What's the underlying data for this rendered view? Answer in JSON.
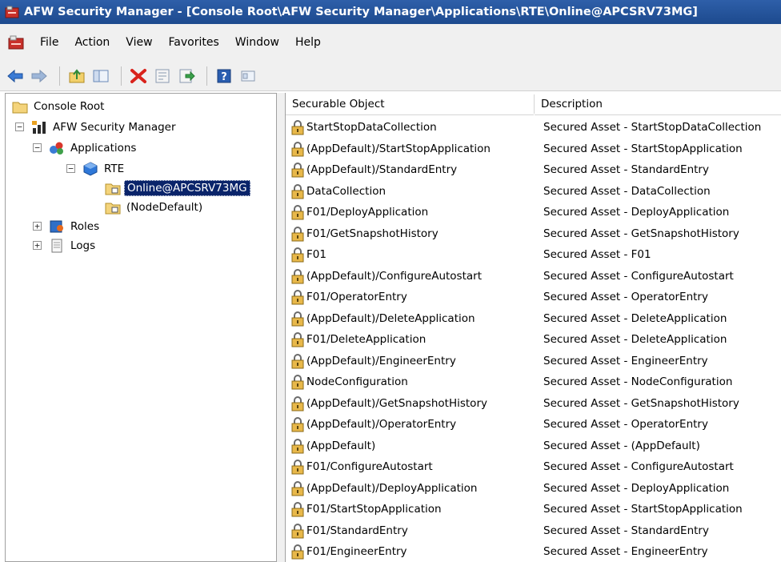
{
  "window": {
    "title": "AFW Security Manager - [Console Root\\AFW Security Manager\\Applications\\RTE\\Online@APCSRV73MG]"
  },
  "menu": [
    "File",
    "Action",
    "View",
    "Favorites",
    "Window",
    "Help"
  ],
  "toolbar": {
    "buttons": [
      "back-icon",
      "forward-icon",
      "up-folder-icon",
      "show-hide-tree-icon",
      "delete-icon",
      "properties-icon",
      "export-list-icon",
      "help-icon",
      "view-icon"
    ]
  },
  "tree": {
    "console_root": "Console Root",
    "afw_security_manager": "AFW Security Manager",
    "applications": "Applications",
    "rte": "RTE",
    "online": "Online@APCSRV73MG",
    "node_default": "(NodeDefault)",
    "roles": "Roles",
    "logs": "Logs"
  },
  "table": {
    "columns": [
      "Securable Object",
      "Description"
    ],
    "rows": [
      {
        "object": "StartStopDataCollection",
        "description": "Secured Asset - StartStopDataCollection"
      },
      {
        "object": "(AppDefault)/StartStopApplication",
        "description": "Secured Asset - StartStopApplication"
      },
      {
        "object": "(AppDefault)/StandardEntry",
        "description": "Secured Asset - StandardEntry"
      },
      {
        "object": "DataCollection",
        "description": "Secured Asset - DataCollection"
      },
      {
        "object": "F01/DeployApplication",
        "description": "Secured Asset - DeployApplication"
      },
      {
        "object": "F01/GetSnapshotHistory",
        "description": "Secured Asset - GetSnapshotHistory"
      },
      {
        "object": "F01",
        "description": "Secured Asset - F01"
      },
      {
        "object": "(AppDefault)/ConfigureAutostart",
        "description": "Secured Asset - ConfigureAutostart"
      },
      {
        "object": "F01/OperatorEntry",
        "description": "Secured Asset - OperatorEntry"
      },
      {
        "object": "(AppDefault)/DeleteApplication",
        "description": "Secured Asset - DeleteApplication"
      },
      {
        "object": "F01/DeleteApplication",
        "description": "Secured Asset - DeleteApplication"
      },
      {
        "object": "(AppDefault)/EngineerEntry",
        "description": "Secured Asset - EngineerEntry"
      },
      {
        "object": "NodeConfiguration",
        "description": "Secured Asset - NodeConfiguration"
      },
      {
        "object": "(AppDefault)/GetSnapshotHistory",
        "description": "Secured Asset - GetSnapshotHistory"
      },
      {
        "object": "(AppDefault)/OperatorEntry",
        "description": "Secured Asset - OperatorEntry"
      },
      {
        "object": "(AppDefault)",
        "description": "Secured Asset - (AppDefault)"
      },
      {
        "object": "F01/ConfigureAutostart",
        "description": "Secured Asset - ConfigureAutostart"
      },
      {
        "object": "(AppDefault)/DeployApplication",
        "description": "Secured Asset - DeployApplication"
      },
      {
        "object": "F01/StartStopApplication",
        "description": "Secured Asset - StartStopApplication"
      },
      {
        "object": "F01/StandardEntry",
        "description": "Secured Asset - StandardEntry"
      },
      {
        "object": "F01/EngineerEntry",
        "description": "Secured Asset - EngineerEntry"
      }
    ]
  },
  "colors": {
    "titlebar": "#1d4a8e",
    "selection": "#0a246a",
    "chrome": "#f0f0f0"
  }
}
